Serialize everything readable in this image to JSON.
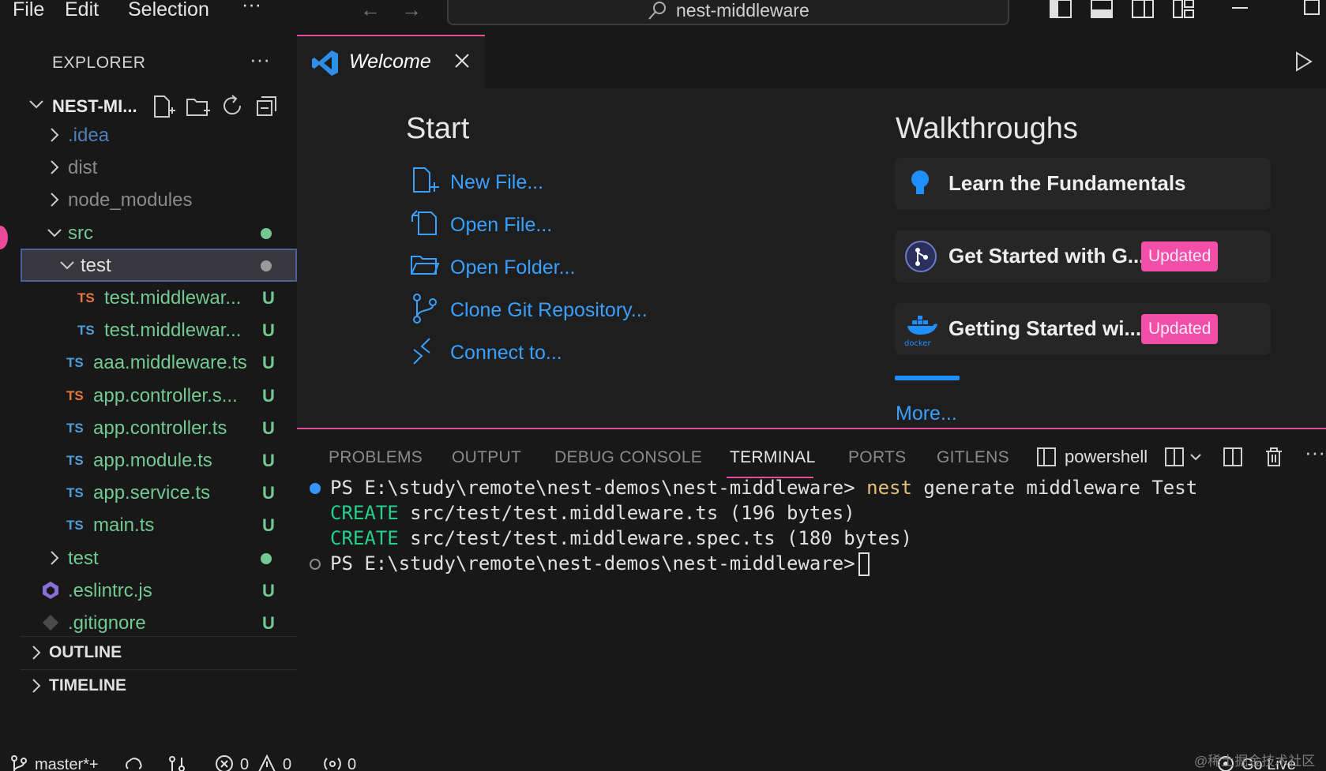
{
  "titlebar": {
    "menus": [
      "File",
      "Edit",
      "Selection",
      "···"
    ],
    "search_text": "nest-middleware"
  },
  "sidebar": {
    "title": "EXPLORER",
    "more": "···",
    "root_label": "NEST-MI...",
    "tree": [
      {
        "name": ".idea",
        "kind": "folder"
      },
      {
        "name": "dist",
        "kind": "folder"
      },
      {
        "name": "node_modules",
        "kind": "folder"
      },
      {
        "name": "src",
        "kind": "folder-open"
      },
      {
        "name": "test",
        "kind": "folder-open"
      },
      {
        "name": "test.middlewar...",
        "kind": "ts",
        "status": "U"
      },
      {
        "name": "test.middlewar...",
        "kind": "ts",
        "status": "U"
      },
      {
        "name": "aaa.middleware.ts",
        "kind": "ts",
        "status": "U"
      },
      {
        "name": "app.controller.s...",
        "kind": "ts",
        "status": "U"
      },
      {
        "name": "app.controller.ts",
        "kind": "ts",
        "status": "U"
      },
      {
        "name": "app.module.ts",
        "kind": "ts",
        "status": "U"
      },
      {
        "name": "app.service.ts",
        "kind": "ts",
        "status": "U"
      },
      {
        "name": "main.ts",
        "kind": "ts",
        "status": "U"
      },
      {
        "name": "test",
        "kind": "folder"
      },
      {
        "name": ".eslintrc.js",
        "kind": "eslint",
        "status": "U"
      },
      {
        "name": ".gitignore",
        "kind": "git",
        "status": "U"
      }
    ],
    "ts_badge": "TS",
    "sections": [
      "OUTLINE",
      "TIMELINE"
    ]
  },
  "editor": {
    "tab_title": "Welcome",
    "start_heading": "Start",
    "start_items": [
      "New File...",
      "Open File...",
      "Open Folder...",
      "Clone Git Repository...",
      "Connect to..."
    ],
    "walk_heading": "Walkthroughs",
    "walk_items": [
      {
        "label": "Learn the Fundamentals",
        "badge": ""
      },
      {
        "label": "Get Started with G...",
        "badge": "Updated"
      },
      {
        "label": "Getting Started wi...",
        "badge": "Updated"
      }
    ],
    "docker_caption": "docker",
    "more": "More..."
  },
  "panel": {
    "tabs": [
      "PROBLEMS",
      "OUTPUT",
      "DEBUG CONSOLE",
      "TERMINAL",
      "PORTS",
      "GITLENS"
    ],
    "active_tab": "TERMINAL",
    "shell": "powershell",
    "terminal": {
      "prompt": "PS E:\\study\\remote\\nest-demos\\nest-middleware>",
      "command_keyword": "nest",
      "command_rest": " generate middleware Test",
      "create_label": "CREATE",
      "create_lines": [
        " src/test/test.middleware.ts (196 bytes)",
        " src/test/test.middleware.spec.ts (180 bytes)"
      ]
    }
  },
  "statusbar": {
    "branch": "master*+",
    "errors": "0",
    "warnings": "0",
    "ports": "0",
    "golive": "Go Live"
  },
  "watermark": "@稀土掘金技术社区",
  "colors": {
    "accent": "#e94a9a",
    "link": "#3aa0ff",
    "untracked": "#73c991",
    "ts_blue": "#4f9ed8",
    "ts_orange": "#e8773d"
  }
}
